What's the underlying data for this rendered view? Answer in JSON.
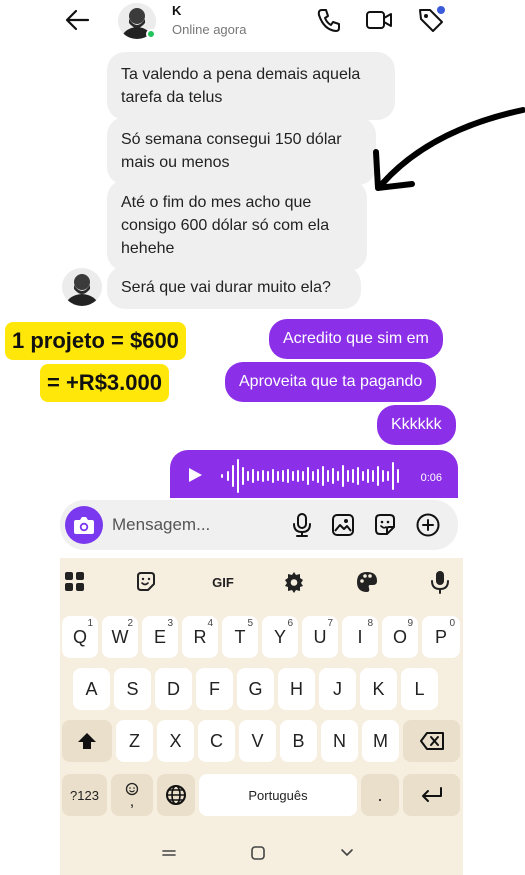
{
  "header": {
    "contact_name": "K",
    "status": "Online agora",
    "icons": [
      "back-arrow-icon",
      "phone-icon",
      "video-camera-icon",
      "tag-icon"
    ]
  },
  "messages_in": [
    "Ta valendo a pena demais aquela tarefa da telus",
    "Só semana consegui 150 dólar mais ou menos",
    "Até o fim do mes acho que consigo 600 dólar só com ela hehehe",
    "Será que vai durar muito ela?"
  ],
  "messages_out": [
    "Acredito que sim em",
    "Aproveita que ta pagando",
    "Kkkkkk"
  ],
  "voice_note": {
    "duration": "0:06"
  },
  "annotation": {
    "line1": "1 projeto = $600",
    "line2": "= +R$3.000"
  },
  "composer": {
    "placeholder": "Mensagem..."
  },
  "keyboard": {
    "toolbar": [
      "grid-icon",
      "sticker-icon",
      "GIF",
      "settings-icon",
      "palette-icon",
      "mic-icon"
    ],
    "gif_label": "GIF",
    "row1": [
      "Q",
      "W",
      "E",
      "R",
      "T",
      "Y",
      "U",
      "I",
      "O",
      "P"
    ],
    "row1_hints": [
      "1",
      "2",
      "3",
      "4",
      "5",
      "6",
      "7",
      "8",
      "9",
      "0"
    ],
    "row2": [
      "A",
      "S",
      "D",
      "F",
      "G",
      "H",
      "J",
      "K",
      "L"
    ],
    "row3": [
      "Z",
      "X",
      "C",
      "V",
      "B",
      "N",
      "M"
    ],
    "symbols_label": "?123",
    "emoji_comma": ",",
    "space_label": "Português",
    "period_label": "."
  },
  "colors": {
    "accent": "#8b2fe8",
    "highlight": "#ffe70a",
    "keyboard_bg": "#f6eede",
    "bubble_in": "#efefef"
  }
}
